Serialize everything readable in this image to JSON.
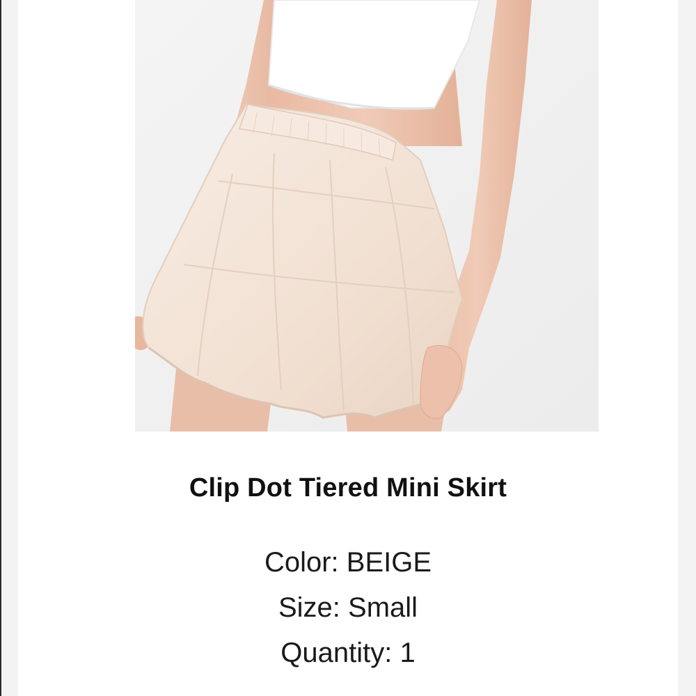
{
  "product": {
    "name": "Clip Dot Tiered Mini Skirt",
    "image_alt": "Clip Dot Tiered Mini Skirt",
    "details": {
      "color_label": "Color:",
      "color_value": "BEIGE",
      "size_label": "Size:",
      "size_value": "Small",
      "quantity_label": "Quantity:",
      "quantity_value": "1"
    }
  },
  "colors": {
    "skirt": "#f4e6da",
    "top": "#ffffff",
    "skin": "#ecc3ad",
    "background": "#f1f1f1",
    "text": "#111111"
  }
}
